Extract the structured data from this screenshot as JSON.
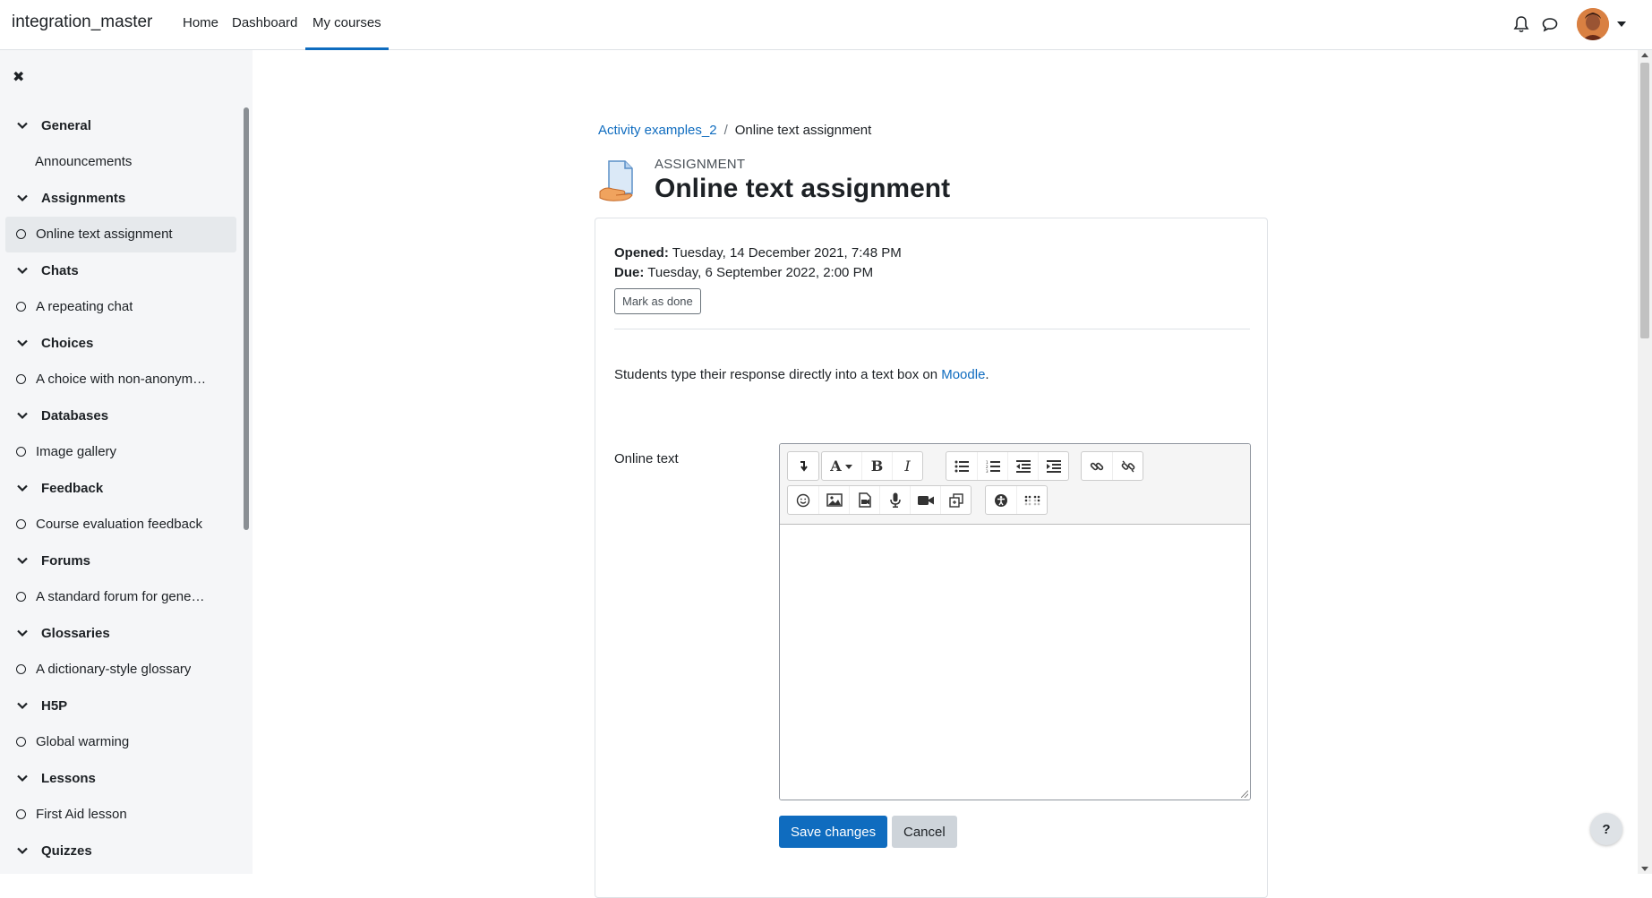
{
  "navbar": {
    "site_name": "integration_master",
    "links": [
      {
        "label": "Home"
      },
      {
        "label": "Dashboard"
      },
      {
        "label": "My courses",
        "active": true
      }
    ],
    "icons": [
      "bell-icon",
      "chat-bubble-icon",
      "avatar",
      "chevron-down-icon"
    ]
  },
  "drawer": {
    "close_icon": "close-icon",
    "sections": [
      {
        "title": "General",
        "items": [
          {
            "label": "Announcements",
            "plain": true
          }
        ]
      },
      {
        "title": "Assignments",
        "items": [
          {
            "label": "Online text assignment",
            "selected": true
          }
        ]
      },
      {
        "title": "Chats",
        "items": [
          {
            "label": "A repeating chat"
          }
        ]
      },
      {
        "title": "Choices",
        "items": [
          {
            "label": "A choice with non-anonym…"
          }
        ]
      },
      {
        "title": "Databases",
        "items": [
          {
            "label": "Image gallery"
          }
        ]
      },
      {
        "title": "Feedback",
        "items": [
          {
            "label": "Course evaluation feedback"
          }
        ]
      },
      {
        "title": "Forums",
        "items": [
          {
            "label": "A standard forum for gene…"
          }
        ]
      },
      {
        "title": "Glossaries",
        "items": [
          {
            "label": "A dictionary-style glossary"
          }
        ]
      },
      {
        "title": "H5P",
        "items": [
          {
            "label": "Global warming"
          }
        ]
      },
      {
        "title": "Lessons",
        "items": [
          {
            "label": "First Aid lesson"
          }
        ]
      },
      {
        "title": "Quizzes",
        "items": []
      }
    ]
  },
  "breadcrumb": {
    "course": "Activity examples_2",
    "separator": "/",
    "current": "Online text assignment"
  },
  "header": {
    "activity_type": "ASSIGNMENT",
    "title": "Online text assignment"
  },
  "dates": {
    "opened_label": "Opened:",
    "opened_value": "Tuesday, 14 December 2021, 7:48 PM",
    "due_label": "Due:",
    "due_value": "Tuesday, 6 September 2022, 2:00 PM"
  },
  "mark_done_label": "Mark as done",
  "intro": {
    "text_before": "Students type their response directly into a text box on ",
    "link_text": "Moodle",
    "text_after": "."
  },
  "form": {
    "online_text_label": "Online text",
    "editor_text": "",
    "save_label": "Save changes",
    "cancel_label": "Cancel"
  },
  "help_label": "?",
  "colors": {
    "brand_blue": "#0f6cbf",
    "drawer_bg": "#f5f6f8",
    "selected_bg": "#e6e9ec"
  }
}
